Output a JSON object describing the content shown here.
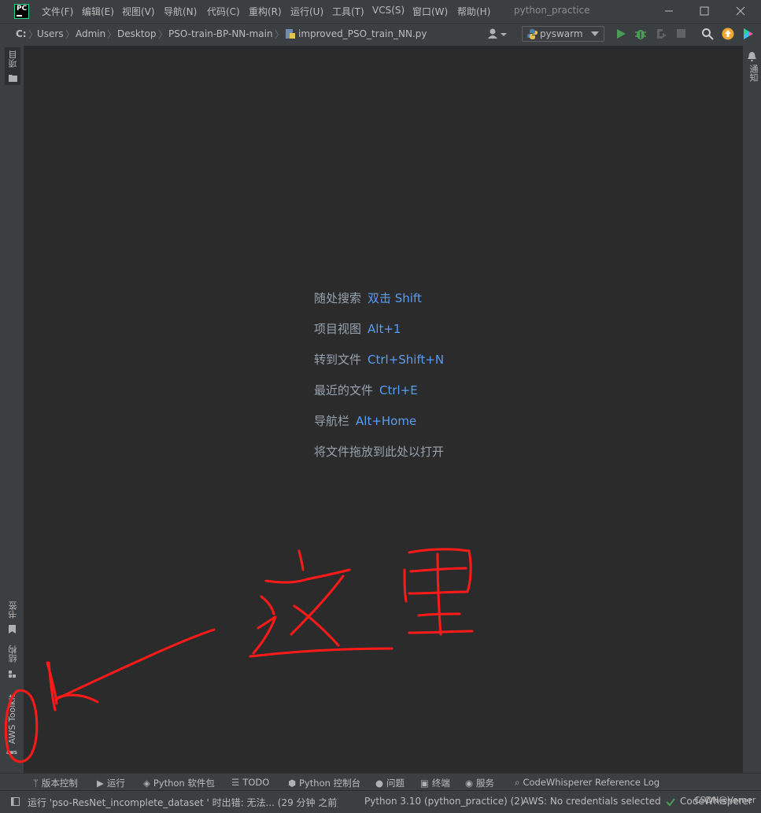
{
  "window": {
    "project_name": "python_practice",
    "menu": [
      "文件(F)",
      "编辑(E)",
      "视图(V)",
      "导航(N)",
      "代码(C)",
      "重构(R)",
      "运行(U)",
      "工具(T)",
      "VCS(S)",
      "窗口(W)",
      "帮助(H)"
    ],
    "logo_text": "PC"
  },
  "navbar": {
    "breadcrumbs": [
      "C:",
      "Users",
      "Admin",
      "Desktop",
      "PSO-train-BP-NN-main",
      "improved_PSO_train_NN.py"
    ],
    "run_config": "pyswarm"
  },
  "left_stripe": {
    "top_tab": "项目",
    "bookmarks_tab": "书签",
    "structure_tab": "结构",
    "aws_tab": "AWS Toolkit",
    "aws_badge": "aws"
  },
  "right_stripe": {
    "notifications_tab": "通知"
  },
  "editor": {
    "hints": [
      {
        "label": "随处搜索",
        "key": "双击 Shift"
      },
      {
        "label": "项目视图",
        "key": "Alt+1"
      },
      {
        "label": "转到文件",
        "key": "Ctrl+Shift+N"
      },
      {
        "label": "最近的文件",
        "key": "Ctrl+E"
      },
      {
        "label": "导航栏",
        "key": "Alt+Home"
      },
      {
        "label": "将文件拖放到此处以打开",
        "key": ""
      }
    ]
  },
  "bottom_tabs": [
    "版本控制",
    "运行",
    "Python 软件包",
    "TODO",
    "Python 控制台",
    "问题",
    "终端",
    "服务",
    "CodeWhisperer Reference Log"
  ],
  "status": {
    "message": "运行 'pso-ResNet_incomplete_dataset ' 时出错: 无法... (29 分钟 之前)",
    "interpreter": "Python 3.10 (python_practice) (2)",
    "aws": "AWS: No credentials selected",
    "codewhisperer": "CodeWhisperer"
  },
  "watermark": "CSDN@Verner",
  "colors": {
    "background": "#2b2b2b",
    "chrome": "#3c3f41",
    "hint_key": "#589df6",
    "annotation": "#ff1a1a"
  }
}
